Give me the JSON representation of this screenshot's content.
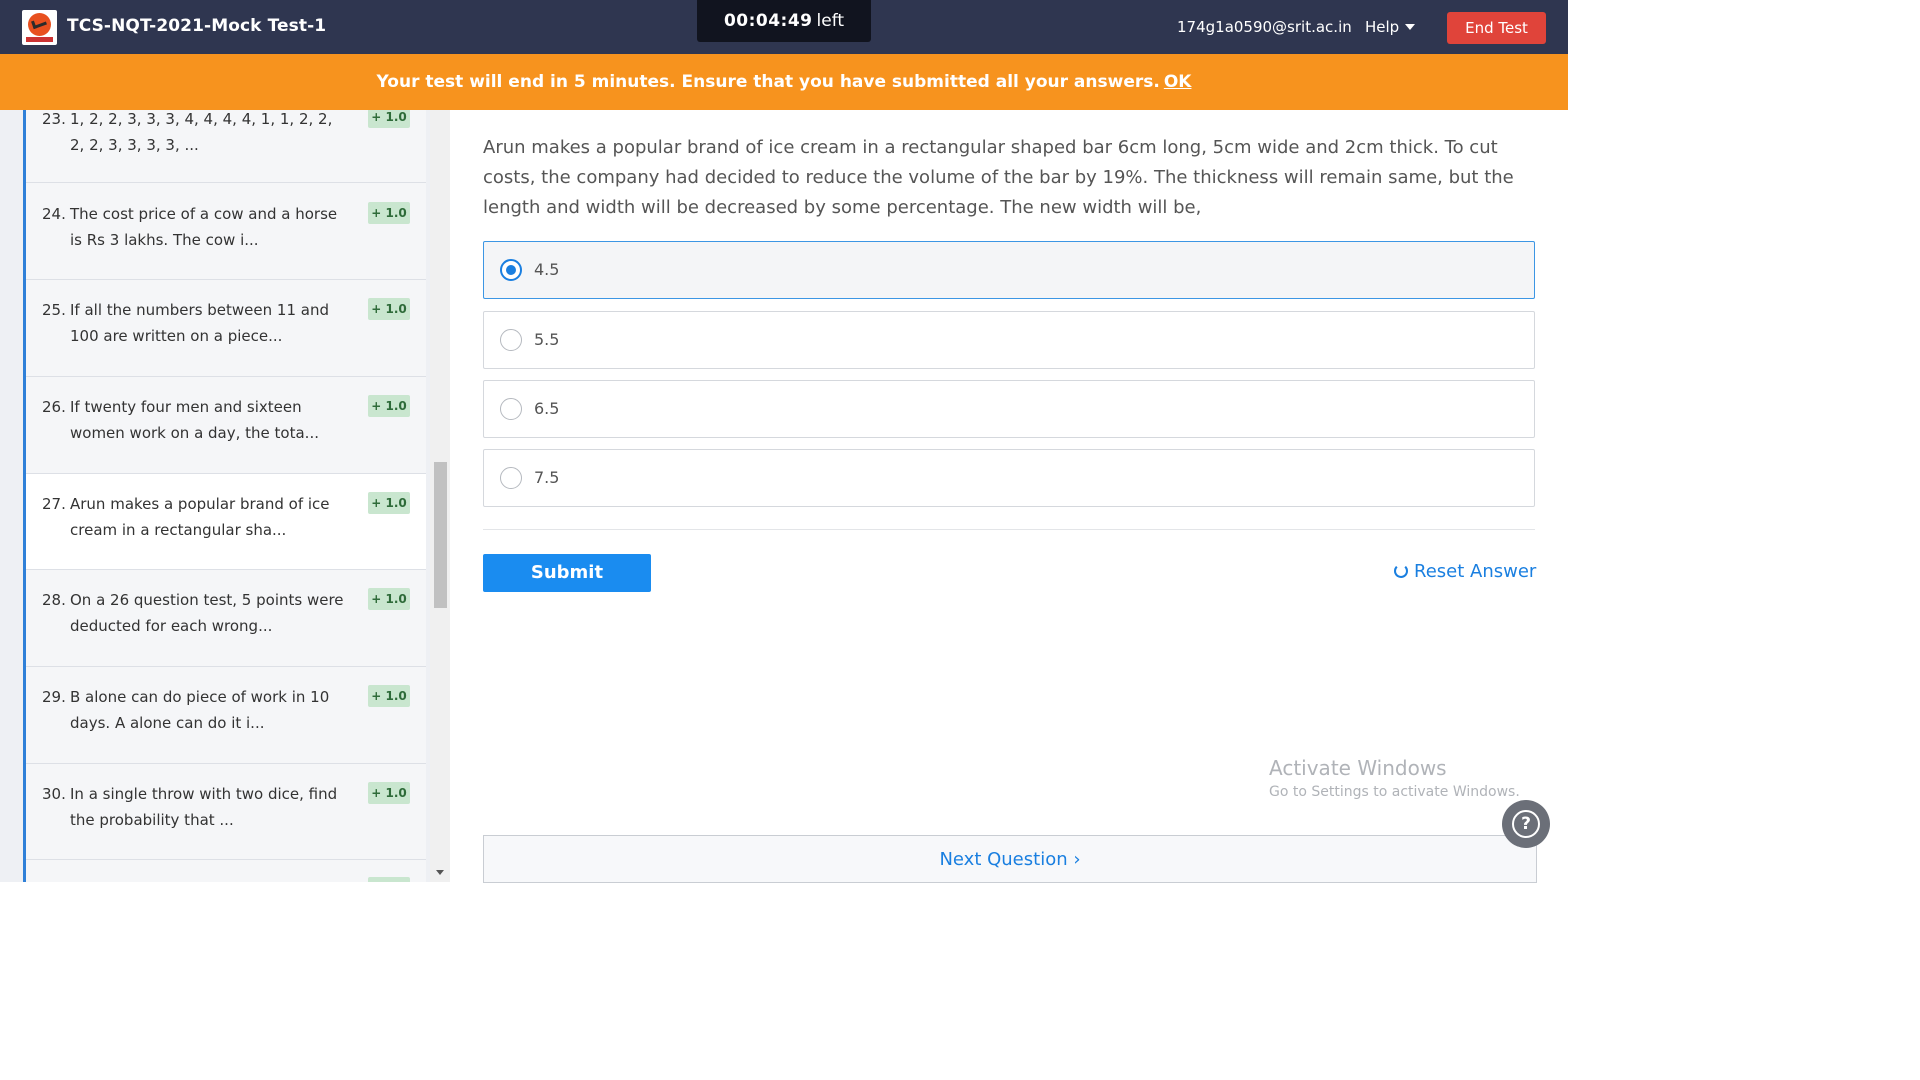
{
  "header": {
    "title": "TCS-NQT-2021-Mock Test-1",
    "timer_value": "00:04:49",
    "timer_suffix": "left",
    "email": "174g1a0590@srit.ac.in",
    "help_label": "Help",
    "end_test_label": "End Test"
  },
  "banner": {
    "message": "Your test will end in 5 minutes. Ensure that you have submitted all your answers.",
    "ok_label": "OK"
  },
  "sidebar": {
    "items": [
      {
        "num": "23.",
        "text": "1, 2, 2, 3, 3, 3, 4, 4, 4, 4, 1, 1, 2, 2, 2, 2, 3, 3, 3, 3, ...",
        "badge": "+ 1.0"
      },
      {
        "num": "24.",
        "text": "The cost price of a cow and a horse is Rs 3 lakhs. The cow i...",
        "badge": "+ 1.0"
      },
      {
        "num": "25.",
        "text": "If all the numbers between 11 and 100 are written on a piece...",
        "badge": "+ 1.0"
      },
      {
        "num": "26.",
        "text": "If twenty four men and sixteen women work on a day, the tota...",
        "badge": "+ 1.0"
      },
      {
        "num": "27.",
        "text": "Arun makes a popular brand of ice cream in a rectangular sha...",
        "badge": "+ 1.0"
      },
      {
        "num": "28.",
        "text": "On a 26 question test, 5 points were deducted for each wrong...",
        "badge": "+ 1.0"
      },
      {
        "num": "29.",
        "text": "B alone can do piece of work in 10 days. A alone can do it i...",
        "badge": "+ 1.0"
      },
      {
        "num": "30.",
        "text": " In a single throw with two dice, find the probability that ...",
        "badge": "+ 1.0"
      },
      {
        "num": "",
        "text": "",
        "badge": ""
      }
    ]
  },
  "main": {
    "question": "Arun makes a popular brand of ice cream in a rectangular shaped bar 6cm long, 5cm wide and 2cm thick. To cut costs, the company had decided to reduce the volume of the bar by 19%. The thickness will remain same, but the length and width will be decreased by some percentage. The new width will be,",
    "options": [
      {
        "label": "4.5",
        "selected": true
      },
      {
        "label": "5.5",
        "selected": false
      },
      {
        "label": "6.5",
        "selected": false
      },
      {
        "label": "7.5",
        "selected": false
      }
    ],
    "submit_label": "Submit",
    "reset_label": "Reset Answer",
    "next_label": "Next Question ›"
  },
  "watermark": {
    "line1": "Activate Windows",
    "line2": "Go to Settings to activate Windows."
  },
  "help_fab": "?",
  "colors": {
    "header_bg": "#2f3650",
    "banner_bg": "#f7931e",
    "accent": "#1a8cf0",
    "end_test_bg": "#e0443a"
  }
}
